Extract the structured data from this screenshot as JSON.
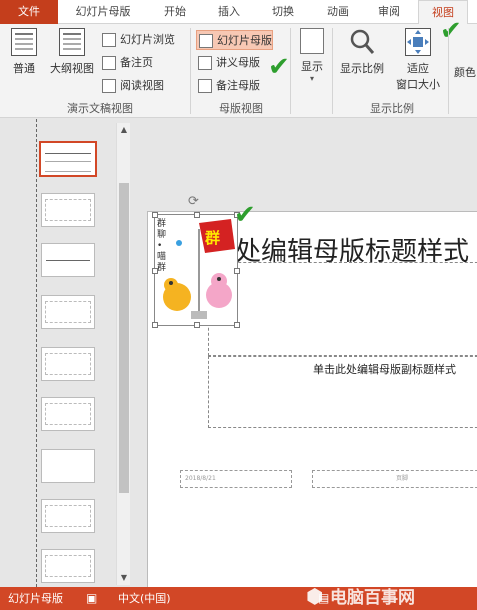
{
  "tabs": {
    "file": "文件",
    "slide_master": "幻灯片母版",
    "home": "开始",
    "insert": "插入",
    "transitions": "切换",
    "animations": "动画",
    "review": "审阅",
    "view": "视图"
  },
  "ribbon": {
    "presentation_views": {
      "normal": "普通",
      "outline": "大纲视图",
      "slide_sorter": "幻灯片浏览",
      "notes_page": "备注页",
      "reading_view": "阅读视图",
      "group_label": "演示文稿视图"
    },
    "master_views": {
      "slide_master": "幻灯片母版",
      "handout_master": "讲义母版",
      "notes_master": "备注母版",
      "group_label": "母版视图"
    },
    "show": {
      "label": "显示"
    },
    "zoom": {
      "zoom": "显示比例",
      "fit_line1": "适应",
      "fit_line2": "窗口大小",
      "group_label": "显示比例"
    },
    "color": {
      "label": "颜色"
    }
  },
  "slide": {
    "title": "单击此处编辑母版标题样式",
    "subtitle": "单击此处编辑母版副标题样式",
    "date": "2018/8/21",
    "footer": "页脚",
    "flag_text": "群",
    "side_text": "群聊•喵群"
  },
  "status": {
    "view_name": "幻灯片母版",
    "language": "中文(中国)"
  },
  "watermark": "电脑百事网"
}
